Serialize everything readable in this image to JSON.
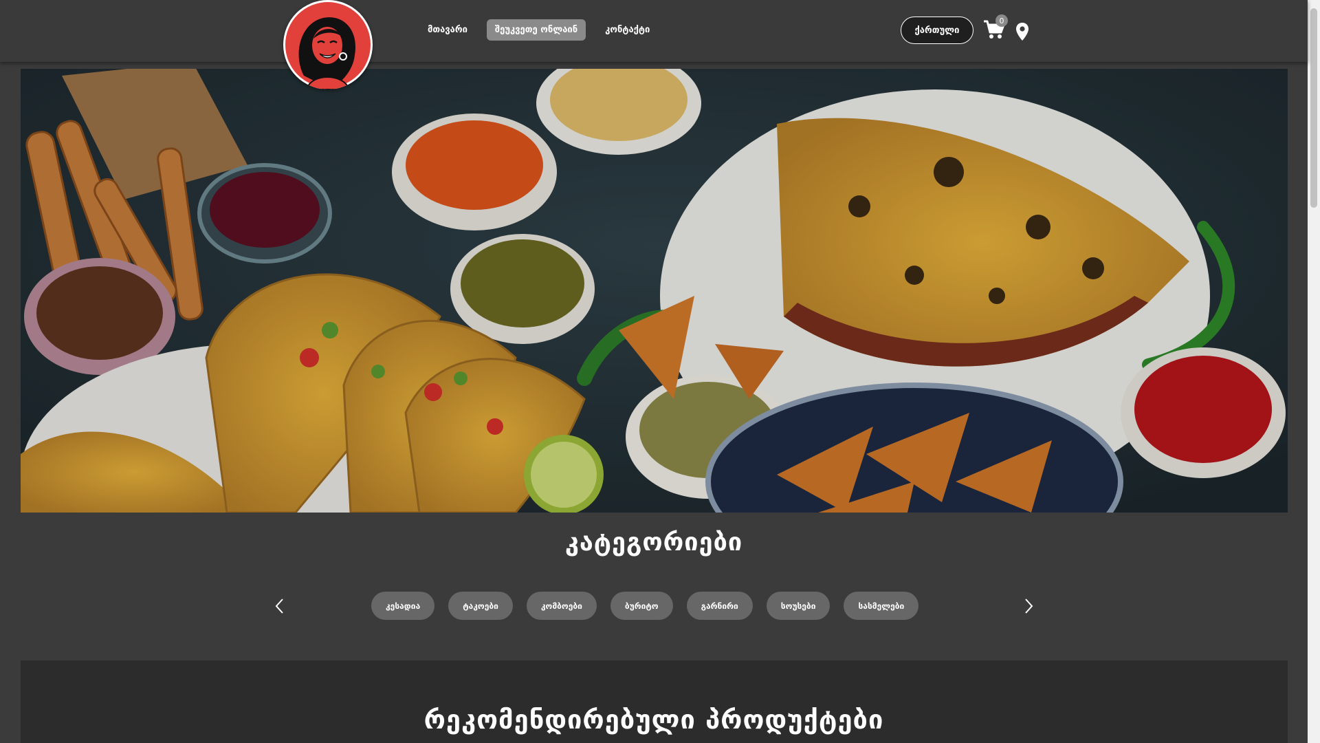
{
  "header": {
    "logo_alt": "",
    "nav": [
      {
        "label": "მთავარი",
        "active": false
      },
      {
        "label": "შეუკვეთე ონლაინ",
        "active": true
      },
      {
        "label": "კონტაქტი",
        "active": false
      }
    ],
    "language_label": "ქართული",
    "cart_count": "0",
    "icons": {
      "cart": "cart-icon",
      "location": "location-pin-icon"
    }
  },
  "hero": {
    "image_desc": "mexican-food-spread"
  },
  "categories": {
    "title": "კატეგორიები",
    "items": [
      "კესადია",
      "ტაკოები",
      "კომბოები",
      "ბურიტო",
      "გარნირი",
      "სოუსები",
      "სასმელები"
    ],
    "icons": {
      "prev": "chevron-left-icon",
      "next": "chevron-right-icon"
    }
  },
  "recommended": {
    "title": "რეკომენდირებული პროდუქტები"
  },
  "colors": {
    "background": "#3b3b3b",
    "pill": "#676767",
    "active_nav": "#8a8a8a",
    "logo_red": "#e2403a"
  }
}
